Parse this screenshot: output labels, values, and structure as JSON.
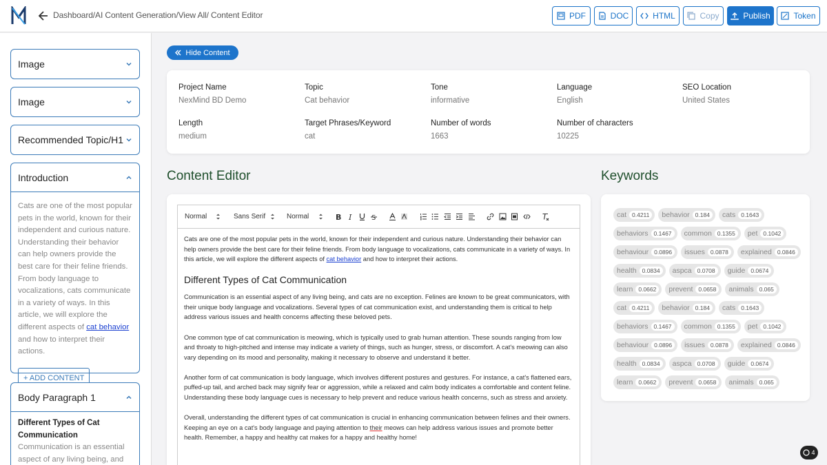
{
  "header": {
    "breadcrumb": "Dashboard/AI Content Generation/View All/ Content Editor",
    "buttons": {
      "pdf": "PDF",
      "doc": "DOC",
      "html": "HTML",
      "copy": "Copy",
      "publish": "Publish",
      "token": "Token"
    }
  },
  "sidebar": {
    "sections": {
      "image1": "Image",
      "image2": "Image",
      "topic": "Recommended Topic/H1",
      "intro": "Introduction",
      "body1": "Body Paragraph 1"
    },
    "intro_text_before": "Cats are one of the most popular pets in the world, known for their independent and curious nature. Understanding their behavior can help owners provide the best care for their feline friends. From body language to vocalizations, cats communicate in a variety of ways. In this article, we will explore the different aspects of ",
    "intro_link": "cat behavior",
    "intro_text_after": " and how to interpret their actions.",
    "add_content": "+ ADD CONTENT",
    "body1_title": "Different Types of Cat Communication",
    "body1_text": "Communication is an essential aspect of any living being, and cats"
  },
  "main": {
    "hide_content": "Hide Content",
    "info": {
      "project_name_label": "Project Name",
      "project_name": "NexMind BD Demo",
      "topic_label": "Topic",
      "topic": "Cat behavior",
      "tone_label": "Tone",
      "tone": "informative",
      "language_label": "Language",
      "language": "English",
      "seo_label": "SEO Location",
      "seo": "United States",
      "length_label": "Length",
      "length": "medium",
      "phrases_label": "Target Phrases/Keyword",
      "phrases": "cat",
      "words_label": "Number of words",
      "words": "1663",
      "chars_label": "Number of characters",
      "chars": "10225"
    },
    "editor_title": "Content Editor",
    "keywords_title": "Keywords",
    "toolbar": {
      "heading": "Normal",
      "font": "Sans Serif",
      "size": "Normal"
    },
    "editor": {
      "p1_before": "Cats are one of the most popular pets in the world, known for their independent and curious nature. Understanding their behavior can help owners provide the best care for their feline friends. From body language to vocalizations, cats communicate in a variety of ways. In this article, we will explore the different aspects of ",
      "p1_link": "cat behavior",
      "p1_after": " and how to interpret their actions.",
      "h2": "Different Types of Cat Communication",
      "p2": "Communication is an essential aspect of any living being, and cats are no exception. Felines are known to be great communicators, with their unique body language and vocalizations. Several types of cat communication exist, and understanding them is critical to help address various issues and health concerns affecting these beloved pets.",
      "p3": "One common type of cat communication is meowing, which is typically used to grab human attention. These sounds ranging from low and throaty to high-pitched and intense may indicate a variety of things, such as hunger, stress, or discomfort. A cat's meowing can also vary depending on its mood and personality, making it necessary to observe and understand it better.",
      "p4": "Another form of cat communication is body language, which involves different postures and gestures. For instance, a cat's flattened ears, puffed-up tail, and arched back may signify fear or aggression, while a relaxed and calm body indicates a comfortable and content feline. Understanding these body language cues is necessary to help prevent and reduce various health concerns, such as stress and anxiety.",
      "p5_before": "Overall, understanding the different types of cat communication is crucial in enhancing communication between felines and their owners. Keeping an eye on a cat's body language and paying attention to ",
      "p5_err": "their",
      "p5_after": " meows can help address various issues and promote better health. Remember, a happy and healthy cat makes for a happy and healthy home!"
    },
    "keywords": [
      [
        {
          "w": "cat",
          "s": "0.4211"
        },
        {
          "w": "behavior",
          "s": "0.184"
        },
        {
          "w": "cats",
          "s": "0.1643"
        }
      ],
      [
        {
          "w": "behaviors",
          "s": "0.1467"
        },
        {
          "w": "common",
          "s": "0.1355"
        },
        {
          "w": "pet",
          "s": "0.1042"
        }
      ],
      [
        {
          "w": "behaviour",
          "s": "0.0896"
        },
        {
          "w": "issues",
          "s": "0.0878"
        },
        {
          "w": "explained",
          "s": "0.0846"
        }
      ],
      [
        {
          "w": "health",
          "s": "0.0834"
        },
        {
          "w": "aspca",
          "s": "0.0708"
        },
        {
          "w": "guide",
          "s": "0.0674"
        }
      ],
      [
        {
          "w": "learn",
          "s": "0.0662"
        },
        {
          "w": "prevent",
          "s": "0.0658"
        },
        {
          "w": "animals",
          "s": "0.065"
        }
      ],
      [
        {
          "w": "cat",
          "s": "0.4211"
        },
        {
          "w": "behavior",
          "s": "0.184"
        },
        {
          "w": "cats",
          "s": "0.1643"
        }
      ],
      [
        {
          "w": "behaviors",
          "s": "0.1467"
        },
        {
          "w": "common",
          "s": "0.1355"
        },
        {
          "w": "pet",
          "s": "0.1042"
        }
      ],
      [
        {
          "w": "behaviour",
          "s": "0.0896"
        },
        {
          "w": "issues",
          "s": "0.0878"
        },
        {
          "w": "explained",
          "s": "0.0846"
        }
      ],
      [
        {
          "w": "health",
          "s": "0.0834"
        },
        {
          "w": "aspca",
          "s": "0.0708"
        },
        {
          "w": "guide",
          "s": "0.0674"
        }
      ],
      [
        {
          "w": "learn",
          "s": "0.0662"
        },
        {
          "w": "prevent",
          "s": "0.0658"
        },
        {
          "w": "animals",
          "s": "0.065"
        }
      ]
    ],
    "fab_count": "4"
  },
  "colors": {
    "accent": "#1d74cb",
    "heading_green": "#1f4f2c",
    "link": "#1a3fd0"
  }
}
